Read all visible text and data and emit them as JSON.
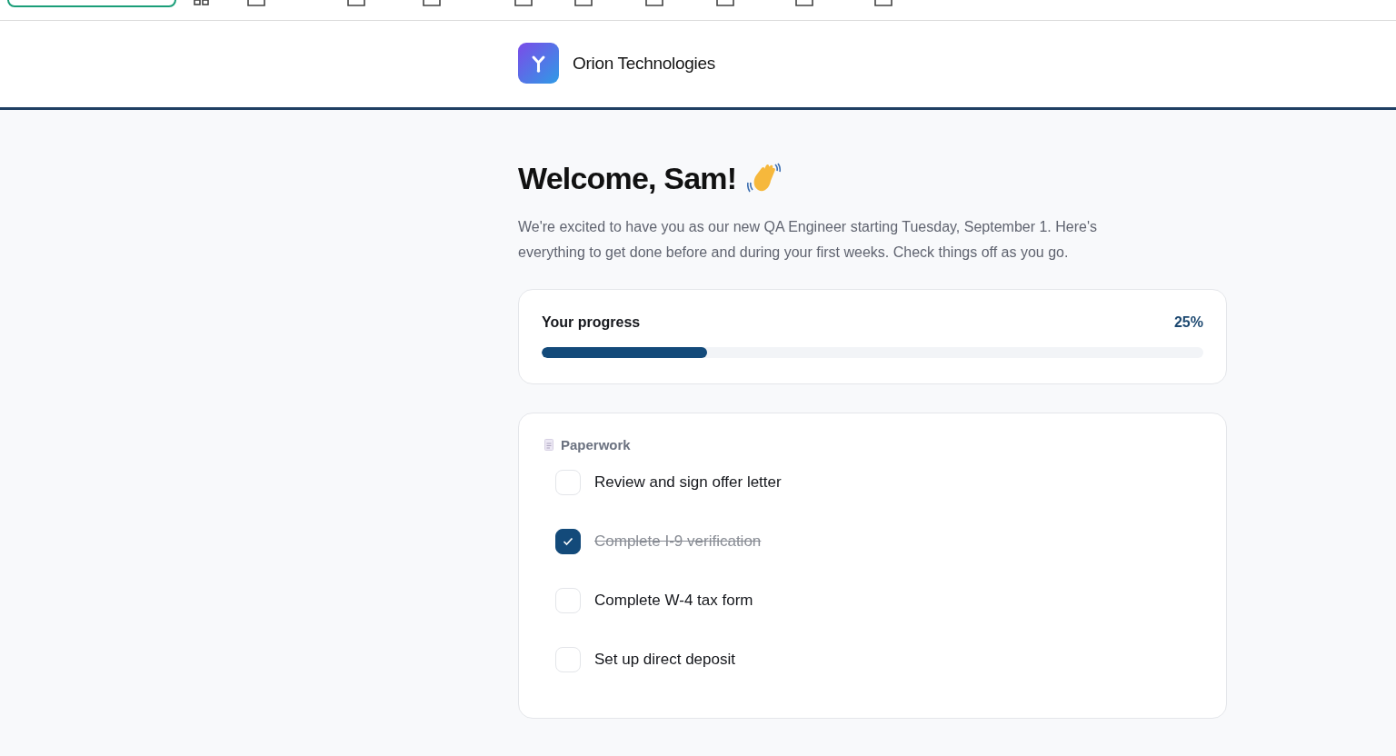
{
  "bookmarks_bar": {
    "items": [
      {
        "kind": "group"
      },
      {
        "kind": "apps"
      },
      {
        "kind": "folder"
      },
      {
        "kind": "folder"
      },
      {
        "kind": "folder"
      },
      {
        "kind": "folder"
      },
      {
        "kind": "folder"
      },
      {
        "kind": "folder"
      },
      {
        "kind": "folder"
      },
      {
        "kind": "folder"
      },
      {
        "kind": "folder"
      }
    ]
  },
  "header": {
    "company": "Orion Technologies"
  },
  "welcome": {
    "title": "Welcome, Sam!",
    "intro": "We're excited to have you as our new QA Engineer starting Tuesday, September 1. Here's everything to get done before and during your first weeks. Check things off as you go."
  },
  "progress": {
    "label": "Your progress",
    "percent": "25%",
    "level": 0.25
  },
  "section": {
    "title": "Paperwork",
    "tasks": [
      {
        "label": "Review and sign offer letter",
        "checked": false
      },
      {
        "label": "Complete I-9 verification",
        "checked": true
      },
      {
        "label": "Complete W-4 tax form",
        "checked": false
      },
      {
        "label": "Set up direct deposit",
        "checked": false
      }
    ]
  }
}
